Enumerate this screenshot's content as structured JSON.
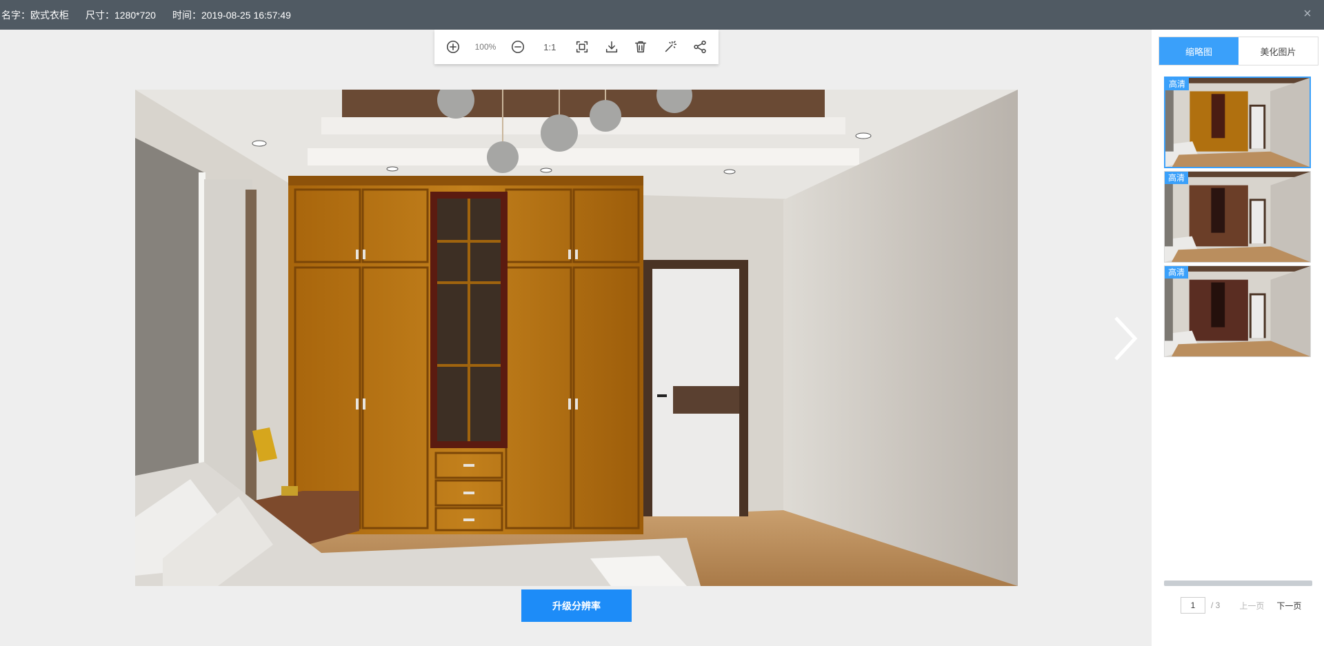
{
  "header": {
    "name_label": "名字：欧式衣柜",
    "size_label": "尺寸：1280*720",
    "time_label": "时间：2019-08-25 16:57:49",
    "close_glyph": "×"
  },
  "toolbar": {
    "zoom_level": "100%",
    "actual_size_label": "1:1",
    "icons": [
      "zoom-in-icon",
      "zoom-out-icon",
      "fit-screen-icon",
      "download-icon",
      "delete-icon",
      "magic-wand-icon",
      "share-icon"
    ]
  },
  "main": {
    "upgrade_button": "升级分辨率"
  },
  "panel": {
    "tabs": [
      {
        "label": "缩略图",
        "active": true
      },
      {
        "label": "美化图片",
        "active": false
      }
    ],
    "thumbnails": [
      {
        "badge": "高清",
        "wardrobe_color": "#b0700f",
        "selected": true
      },
      {
        "badge": "高清",
        "wardrobe_color": "#6b3e28",
        "selected": false
      },
      {
        "badge": "高清",
        "wardrobe_color": "#5a2d22",
        "selected": false
      }
    ],
    "pager": {
      "current": "1",
      "total": "/ 3",
      "prev": "上一页",
      "next": "下一页"
    }
  },
  "colors": {
    "accent": "#1d8cf8",
    "topbar": "#505a63",
    "wardrobe": "#b0700f"
  }
}
